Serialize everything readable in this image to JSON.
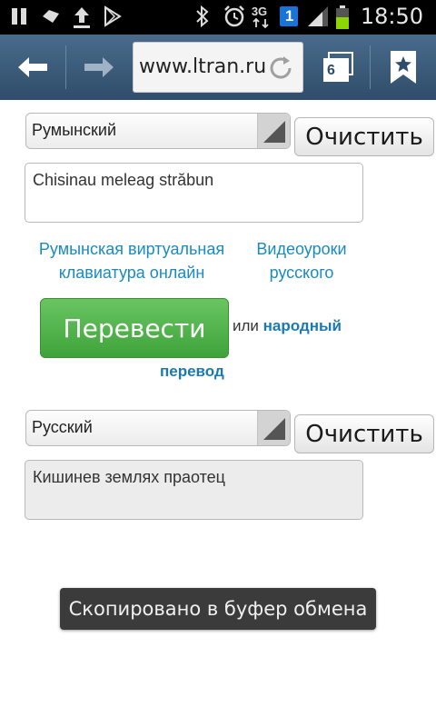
{
  "status_bar": {
    "network": "3G",
    "sim": "1",
    "time": "18:50"
  },
  "browser": {
    "url": "www.ltran.ru",
    "tabs_count": "6"
  },
  "source": {
    "language": "Румынский",
    "clear_label": "Очистить",
    "text": "Chisinau meleag  străbun"
  },
  "links": {
    "keyboard": "Румынская виртуальная клавиатура онлайн",
    "video": "Видеоуроки русского"
  },
  "translate": {
    "button_label": "Перевести",
    "or_text": "или",
    "folk_link_1": "народный",
    "folk_link_2": "перевод"
  },
  "target": {
    "language": "Русский",
    "clear_label": "Очистить",
    "text": "Кишинев землях праотец"
  },
  "toast": "Скопировано в буфер обмена",
  "colors": {
    "toolbar": "#3c5a78",
    "link": "#1a8ac0",
    "translate_button": "#4fb248"
  }
}
